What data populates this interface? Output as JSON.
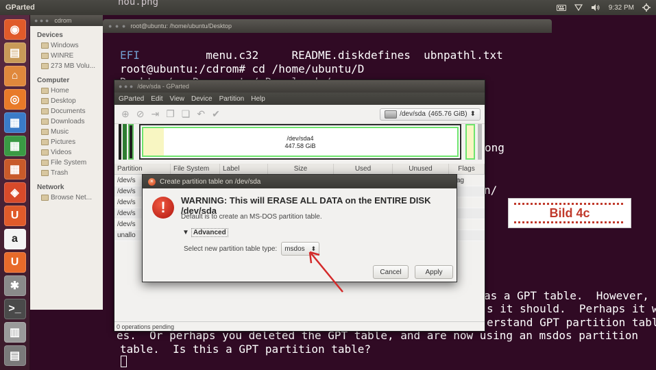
{
  "top_panel": {
    "app_name": "GParted",
    "time": "9:32 PM"
  },
  "launcher": {
    "items": [
      {
        "name": "ubuntu-dash",
        "glyph": "◉",
        "color": "#e05a2a"
      },
      {
        "name": "files",
        "glyph": "▤",
        "color": "#c89a58"
      },
      {
        "name": "home-folder",
        "glyph": "⌂",
        "color": "#e0883c"
      },
      {
        "name": "firefox",
        "glyph": "◎",
        "color": "#e87a28"
      },
      {
        "name": "writer",
        "glyph": "▦",
        "color": "#3a7bc8"
      },
      {
        "name": "calc",
        "glyph": "▦",
        "color": "#3a9a44"
      },
      {
        "name": "impress",
        "glyph": "▦",
        "color": "#c85a2a"
      },
      {
        "name": "software-center",
        "glyph": "◈",
        "color": "#d84a2a"
      },
      {
        "name": "ubuntu-one",
        "glyph": "U",
        "color": "#e05a2a"
      },
      {
        "name": "amazon",
        "glyph": "a",
        "color": "#f4f4f4"
      },
      {
        "name": "ubuntu-one-music",
        "glyph": "U",
        "color": "#e86a2a"
      },
      {
        "name": "system-settings",
        "glyph": "✱",
        "color": "#8a8a8a"
      },
      {
        "name": "terminal",
        "glyph": ">_",
        "color": "#4a4a4a"
      },
      {
        "name": "disks",
        "glyph": "▥",
        "color": "#9a9a9a"
      },
      {
        "name": "workspaces",
        "glyph": "▤",
        "color": "#7a7a7a"
      }
    ]
  },
  "files": {
    "window_title": "cdrom",
    "devices_header": "Devices",
    "devices": [
      "Windows",
      "WINRE",
      "273 MB Volu..."
    ],
    "computer_header": "Computer",
    "computer": [
      "Home",
      "Desktop",
      "Documents",
      "Downloads",
      "Music",
      "Pictures",
      "Videos",
      "File System",
      "Trash"
    ],
    "network_header": "Network",
    "network": [
      "Browse Net..."
    ]
  },
  "terminal": {
    "title": "root@ubuntu: /home/ubuntu/Desktop",
    "line_top": "nou.png",
    "line1_blue": "EFI",
    "line1_rest": "          menu.c32     README.diskdefines  ubnpathl.txt",
    "line2": "root@ubuntu:/cdrom# cd /home/ubuntu/D",
    "line3": "Desktop/   Documents/ Downloads/",
    "frag_ong": "ong",
    "frag_slash": "n/",
    "line_a": "as a GPT table.  However,",
    "line_b": "s it should.  Perhaps it w",
    "line_c": "erstand GPT partition tabl",
    "line_d": "es.  Or perhaps you deleted the GPT table, and are now using an msdos partition",
    "line_e": "table.  Is this a GPT partition table?"
  },
  "gparted": {
    "title": "/dev/sda - GParted",
    "menu": [
      "GParted",
      "Edit",
      "View",
      "Device",
      "Partition",
      "Help"
    ],
    "device": "/dev/sda",
    "device_size": "(465.76 GiB)",
    "sda4_name": "/dev/sda4",
    "sda4_size": "447.58 GiB",
    "columns": [
      "Partition",
      "File System",
      "Label",
      "Size",
      "Used",
      "Unused",
      "Flags"
    ],
    "rows": [
      {
        "partition": "/dev/s",
        "flags": "ag"
      },
      {
        "partition": "/dev/s",
        "flags": ""
      },
      {
        "partition": "/dev/s",
        "flags": ""
      },
      {
        "partition": "/dev/s",
        "flags": ""
      },
      {
        "partition": "/dev/s",
        "flags": ""
      },
      {
        "partition": "unallo",
        "flags": ""
      }
    ],
    "status": "0 operations pending"
  },
  "dialog": {
    "title": "Create partition table on /dev/sda",
    "warning": "WARNING:  This will ERASE ALL DATA on the ENTIRE DISK /dev/sda",
    "sub": "Default is to create an MS-DOS partition table.",
    "advanced_label": "Advanced",
    "select_label": "Select new partition table type:",
    "select_value": "msdos",
    "cancel": "Cancel",
    "apply": "Apply"
  },
  "annotation": {
    "label": "Bild 4c",
    "color": "#c0392b"
  }
}
